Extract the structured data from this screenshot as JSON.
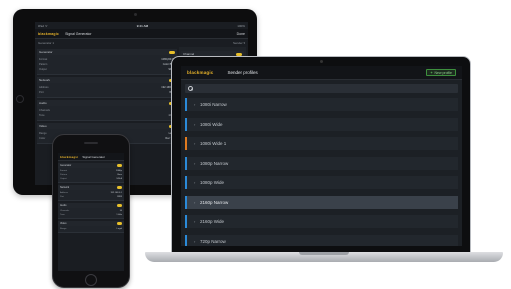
{
  "tablet": {
    "status": {
      "left": "iPad ᯤ",
      "center": "9:41 AM",
      "right": "100%"
    },
    "header": {
      "brand": "blackmagic",
      "title": "Signal Generator",
      "menu": "Done"
    },
    "subbar": {
      "left": "Generator 1",
      "right": "Sender ▾"
    },
    "sections": [
      {
        "label": "Generator",
        "rows": [
          [
            "Format",
            "1080p59.94"
          ],
          [
            "Pattern",
            "Color Bars"
          ],
          [
            "Output",
            "SDI A"
          ]
        ]
      },
      {
        "label": "Network",
        "rows": [
          [
            "Address",
            "192.168.0.1"
          ],
          [
            "Port",
            "9993"
          ]
        ]
      },
      {
        "label": "Audio",
        "rows": [
          [
            "Channels",
            "16"
          ],
          [
            "Tone",
            "1 kHz"
          ]
        ]
      },
      {
        "label": "Video",
        "rows": [
          [
            "Range",
            "Legal"
          ],
          [
            "Color",
            "Rec 709"
          ]
        ]
      }
    ],
    "right_panel": {
      "label": "Channel",
      "rows": [
        [
          "Source",
          "Internal"
        ],
        [
          "Level",
          "-20 dB"
        ],
        [
          "Mode",
          "Auto"
        ],
        [
          "Sync",
          "Locked"
        ],
        [
          "Status",
          "Active"
        ]
      ]
    }
  },
  "phone": {
    "header": {
      "brand": "blackmagic",
      "title": "Signal Generator"
    },
    "sections": [
      {
        "label": "Generator",
        "rows": [
          [
            "Format",
            "1080p"
          ],
          [
            "Pattern",
            "Bars"
          ],
          [
            "Output",
            "SDI A"
          ]
        ]
      },
      {
        "label": "Network",
        "rows": [
          [
            "Address",
            "192.168.0.1"
          ],
          [
            "Port",
            "9993"
          ]
        ]
      },
      {
        "label": "Audio",
        "rows": [
          [
            "Channels",
            "16"
          ],
          [
            "Tone",
            "1 kHz"
          ]
        ]
      },
      {
        "label": "Video",
        "rows": [
          [
            "Range",
            "Legal"
          ]
        ]
      }
    ]
  },
  "laptop": {
    "header": {
      "brand": "blackmagic",
      "title": "Sender profiles",
      "new_button": "New profile"
    },
    "search": {
      "placeholder": "",
      "value": ""
    },
    "profiles": [
      {
        "label": "1080i Narrow",
        "accent": "#2b8ad8",
        "highlighted": false
      },
      {
        "label": "1080i Wide",
        "accent": "#2b8ad8",
        "highlighted": false
      },
      {
        "label": "1080i Wide 1",
        "accent": "#e07a1f",
        "highlighted": false
      },
      {
        "label": "1080p Narrow",
        "accent": "#2b8ad8",
        "highlighted": false
      },
      {
        "label": "1080p Wide",
        "accent": "#2b8ad8",
        "highlighted": false
      },
      {
        "label": "2160p Narrow",
        "accent": "#2b8ad8",
        "highlighted": true
      },
      {
        "label": "2160p Wide",
        "accent": "#2b8ad8",
        "highlighted": false
      },
      {
        "label": "720p Narrow",
        "accent": "#2b8ad8",
        "highlighted": false
      }
    ]
  },
  "colors": {
    "brand": "#e8b32a",
    "accent_blue": "#2b8ad8",
    "accent_orange": "#e07a1f",
    "highlight": "#3a414a",
    "toggle": "#e8c02a"
  },
  "icons": {
    "search": "search-icon",
    "chevron": "chevron-right-icon",
    "add": "plus-icon"
  }
}
